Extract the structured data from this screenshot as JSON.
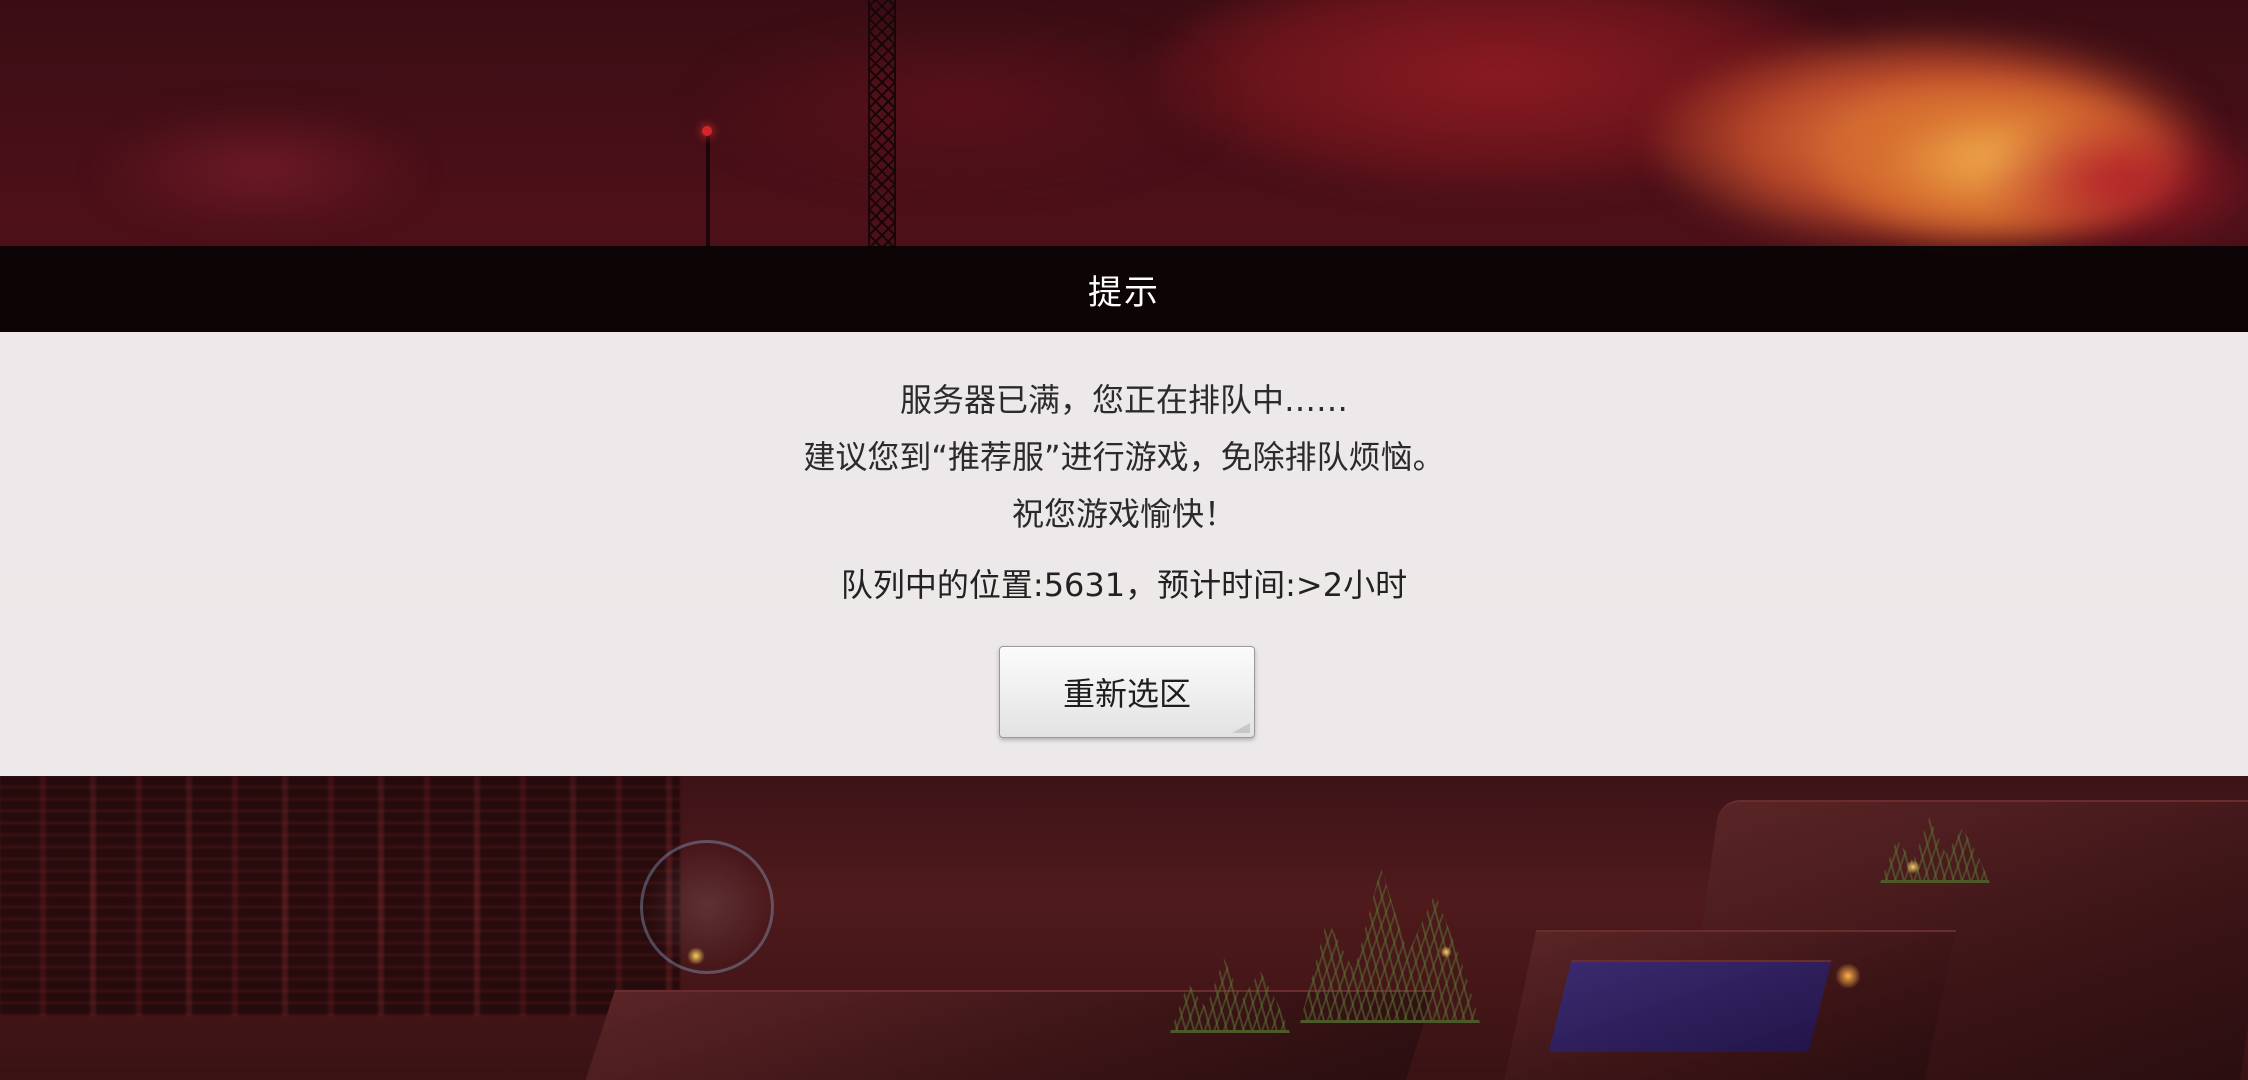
{
  "dialog": {
    "title": "提示",
    "message_lines": [
      "服务器已满，您正在排队中……",
      "建议您到“推荐服”进行游戏，免除排队烦恼。",
      "祝您游戏愉快！"
    ],
    "queue_info": "队列中的位置:5631，预计时间:>2小时",
    "reselect_button_label": "重新选区"
  },
  "queue": {
    "position": 5631,
    "estimated_time": ">2小时"
  },
  "colors": {
    "header_bg": "#080304",
    "body_bg": "#f7f5f5",
    "text": "#2b2b2b",
    "scene_red": "#4d1019",
    "sunset_orange": "#e88a3e"
  }
}
